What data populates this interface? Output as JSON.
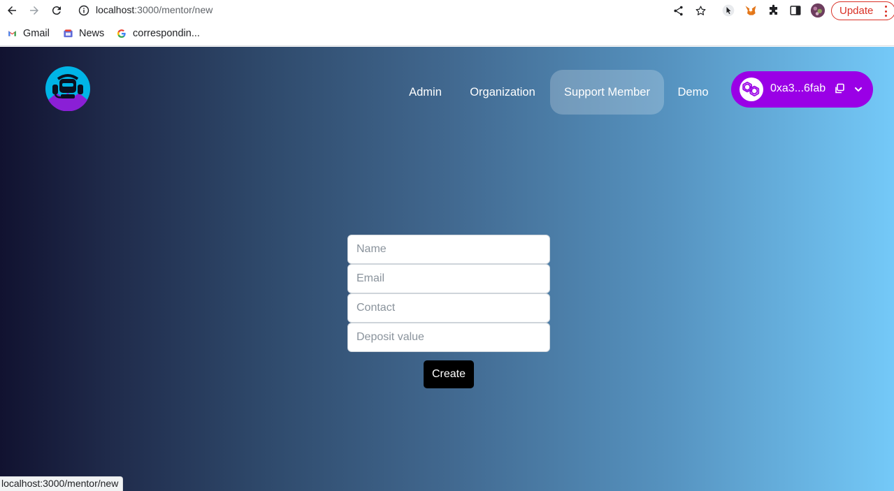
{
  "browser": {
    "url_host": "localhost",
    "url_path": ":3000/mentor/new",
    "update_label": "Update",
    "bookmarks": [
      {
        "label": "Gmail",
        "icon": "gmail-icon"
      },
      {
        "label": "News",
        "icon": "news-icon"
      },
      {
        "label": "correspondin...",
        "icon": "google-icon"
      }
    ],
    "status_text": "localhost:3000/mentor/new"
  },
  "nav": {
    "links": [
      {
        "label": "Admin",
        "active": false
      },
      {
        "label": "Organization",
        "active": false
      },
      {
        "label": "Support Member",
        "active": true
      },
      {
        "label": "Demo",
        "active": false
      }
    ]
  },
  "wallet": {
    "address": "0xa3...6fab",
    "network_icon": "polygon-icon",
    "color": "#9a00e6"
  },
  "form": {
    "name_placeholder": "Name",
    "email_placeholder": "Email",
    "contact_placeholder": "Contact",
    "deposit_placeholder": "Deposit value",
    "submit_label": "Create"
  }
}
